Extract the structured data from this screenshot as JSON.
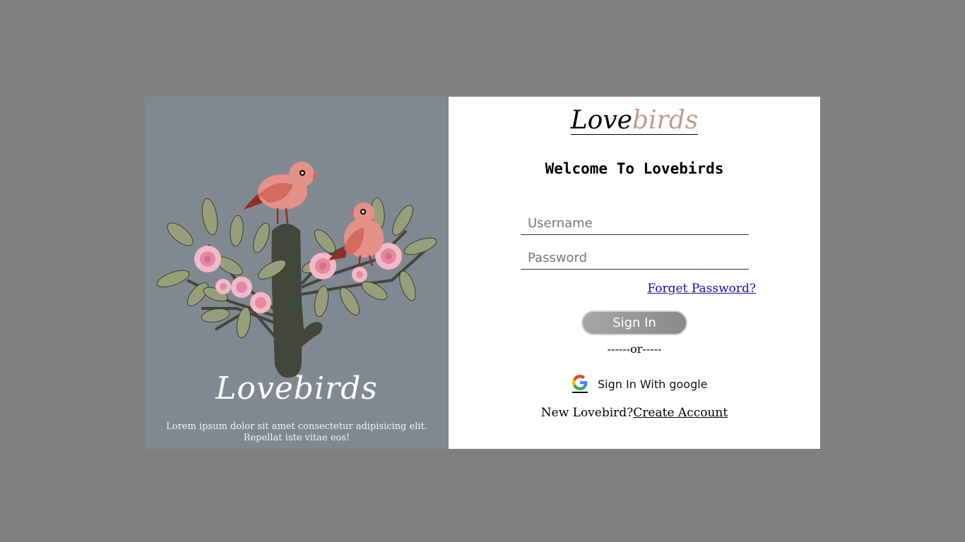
{
  "left_panel": {
    "brand": "Lovebirds",
    "tagline": "Lorem ipsum dolor sit amet consectetur adipisicing elit. Repellat iste vitae eos!",
    "illustration": "two-birds-on-flowering-tree"
  },
  "logo": {
    "part1": "Love",
    "part2": "birds",
    "part1_color": "#000000",
    "part2_color": "#c19a93"
  },
  "welcome_title": "Welcome To Lovebirds",
  "form": {
    "username_placeholder": "Username",
    "username_value": "",
    "password_placeholder": "Password",
    "password_value": "",
    "forgot_label": "Forget Password?",
    "signin_label": "Sign In",
    "separator": "------or-----",
    "google_label": "Sign In With google",
    "google_icon": "google-g-icon"
  },
  "signup": {
    "prompt": "New Lovebird?",
    "link_label": "Create Account"
  },
  "colors": {
    "background": "#808080",
    "left_panel": "#808991",
    "accent_pink": "#c19a93",
    "link_blue": "#1a0dab"
  }
}
